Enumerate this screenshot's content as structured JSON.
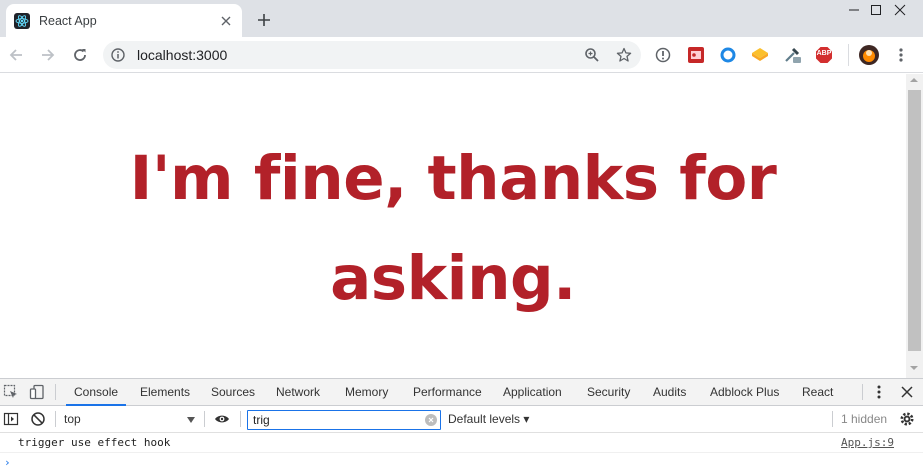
{
  "browser": {
    "tab": {
      "title": "React App"
    },
    "url": "localhost:3000",
    "new_tab_glyph": "+",
    "window_controls": [
      "minimize-icon",
      "maximize-icon",
      "close-icon"
    ],
    "extensions": [
      "page-info-icon",
      "red-extension-icon",
      "blue-ring-icon",
      "yellow-extension-icon",
      "eyedropper-icon",
      "abp-icon",
      "avatar",
      "menu-icon"
    ],
    "abp_label": "ABP"
  },
  "page": {
    "heading": "I'm fine, thanks for asking.",
    "heading_color": "#b22129"
  },
  "devtools": {
    "tabs": [
      "Console",
      "Elements",
      "Sources",
      "Network",
      "Memory",
      "Performance",
      "Application",
      "Security",
      "Audits",
      "Adblock Plus",
      "React"
    ],
    "active_tab": "Console",
    "context": "top",
    "filter_value": "trig",
    "levels": "Default levels ▾",
    "hidden_count": "1 hidden",
    "log": {
      "message": "trigger use effect hook",
      "source": "App.js:9"
    },
    "prompt": "›",
    "accent": "#1a73e8"
  }
}
